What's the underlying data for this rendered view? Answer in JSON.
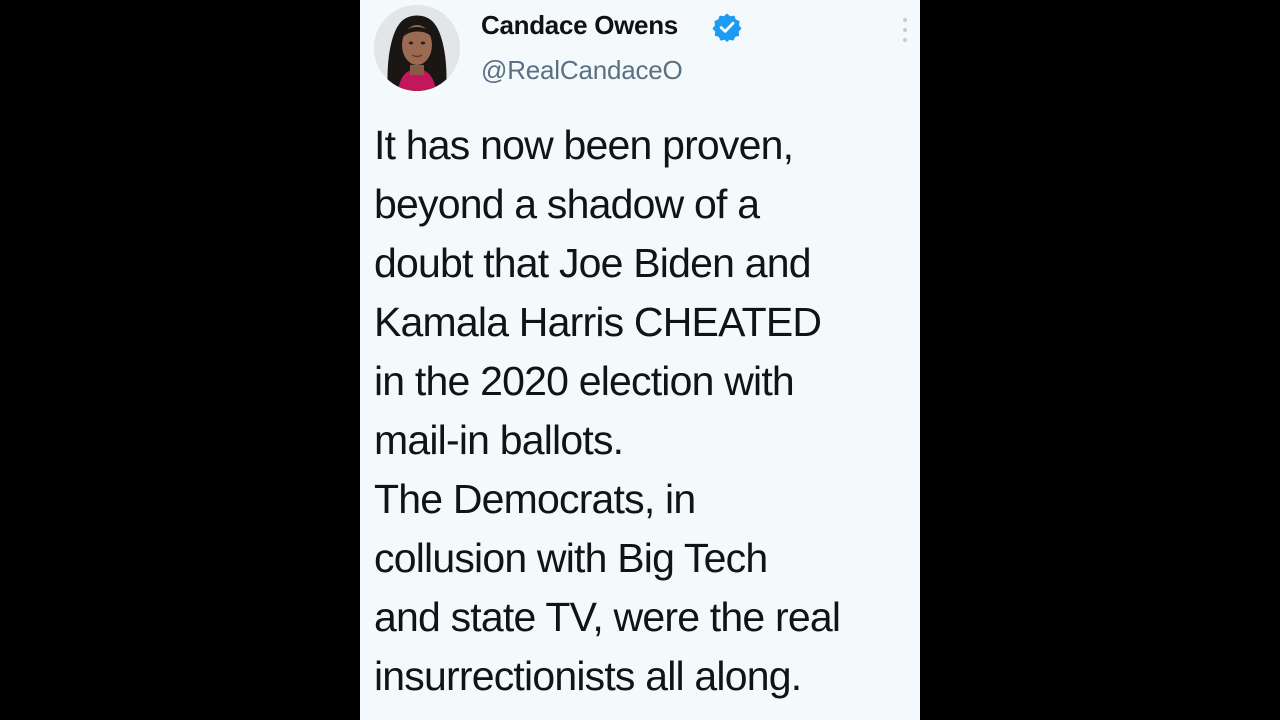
{
  "tweet": {
    "author": {
      "name": "Candace Owens",
      "handle": "@RealCandaceO",
      "verified": true,
      "avatar_icon": "profile-photo",
      "verified_icon": "verified-badge-icon"
    },
    "menu_icon": "more-options-icon",
    "text_lines": [
      "It has now been proven,",
      "beyond a shadow of a",
      "doubt that Joe Biden and",
      "Kamala Harris CHEATED",
      "in the 2020 election with",
      "mail-in ballots.",
      "The Democrats, in",
      "collusion with Big Tech",
      "and state TV, were the real",
      "insurrectionists all along."
    ]
  },
  "colors": {
    "frame_background": "#000000",
    "card_background": "#f4f9fb",
    "name_text": "#111111",
    "handle_text": "#5b7083",
    "body_text": "#0f1419",
    "verified_blue": "#1d9bf0"
  }
}
